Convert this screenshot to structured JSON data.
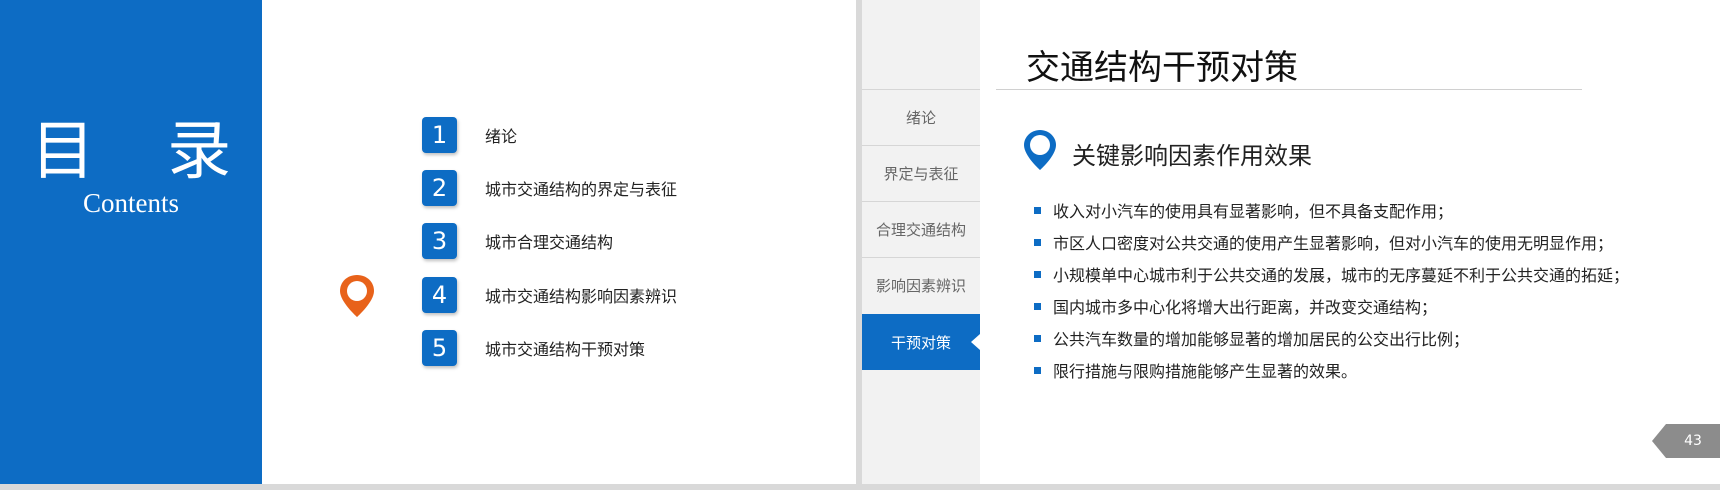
{
  "left_slide": {
    "title": "目 录",
    "subtitle": "Contents",
    "items": [
      {
        "number": "1",
        "label": "绪论"
      },
      {
        "number": "2",
        "label": "城市交通结构的界定与表征"
      },
      {
        "number": "3",
        "label": "城市合理交通结构"
      },
      {
        "number": "4",
        "label": "城市交通结构影响因素辨识"
      },
      {
        "number": "5",
        "label": "城市交通结构干预对策"
      }
    ],
    "current_item": "4",
    "accent_color": "#0d6cc4",
    "marker_color": "#e8621a"
  },
  "right_slide": {
    "nav": [
      {
        "label": "绪论",
        "active": false
      },
      {
        "label": "界定与表征",
        "active": false
      },
      {
        "label": "合理交通结构",
        "active": false
      },
      {
        "label": "影响因素辨识",
        "active": false
      },
      {
        "label": "干预对策",
        "active": true
      }
    ],
    "heading": "交通结构干预对策",
    "section_title": "关键影响因素作用效果",
    "bullets": [
      "收入对小汽车的使用具有显著影响，但不具备支配作用；",
      "市区人口密度对公共交通的使用产生显著影响，但对小汽车的使用无明显作用；",
      "小规模单中心城市利于公共交通的发展，城市的无序蔓延不利于公共交通的拓延；",
      "国内城市多中心化将增大出行距离，并改变交通结构；",
      "公共汽车数量的增加能够显著的增加居民的公交出行比例；",
      "限行措施与限购措施能够产生显著的效果。"
    ],
    "page_number": "43",
    "badge_color": "#8c8c8c"
  }
}
